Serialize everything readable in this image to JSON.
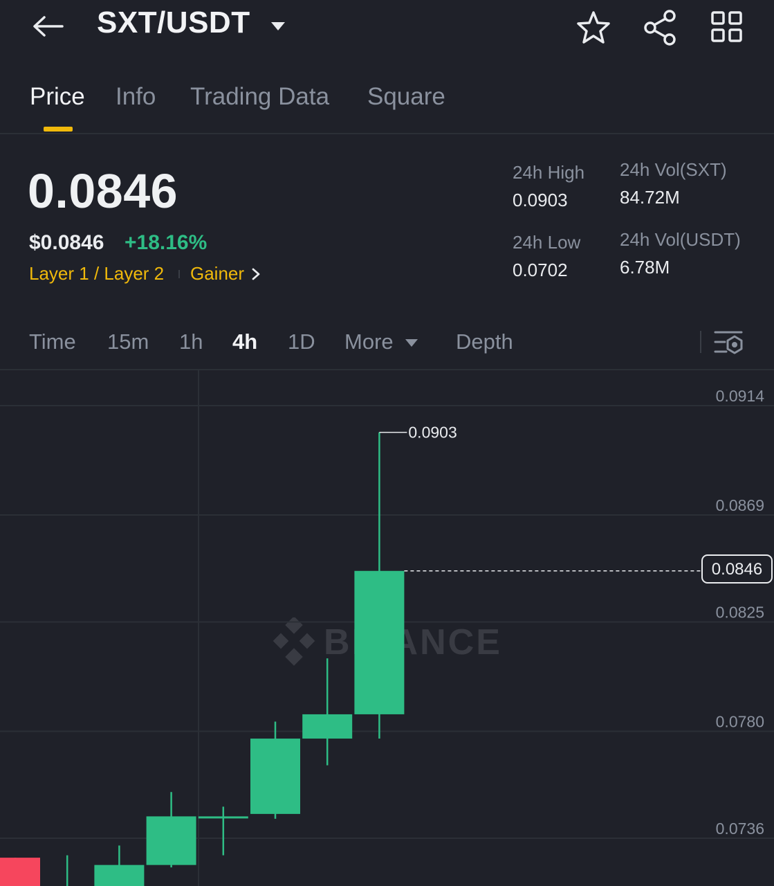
{
  "header": {
    "pair": "SXT/USDT",
    "icons": [
      "back-arrow-icon",
      "caret-down-icon",
      "star-icon",
      "share-icon",
      "grid-icon"
    ]
  },
  "tabs": [
    {
      "label": "Price",
      "active": true
    },
    {
      "label": "Info",
      "active": false
    },
    {
      "label": "Trading Data",
      "active": false
    },
    {
      "label": "Square",
      "active": false
    }
  ],
  "price": {
    "last": "0.0846",
    "usd": "$0.0846",
    "change": "+18.16%",
    "tags": [
      "Layer 1 / Layer 2",
      "Gainer"
    ]
  },
  "stats": {
    "high_label": "24h High",
    "high_value": "0.0903",
    "low_label": "24h Low",
    "low_value": "0.0702",
    "vol_sxt_label": "24h Vol(SXT)",
    "vol_sxt_value": "84.72M",
    "vol_usdt_label": "24h Vol(USDT)",
    "vol_usdt_value": "6.78M"
  },
  "intervals": [
    {
      "label": "Time",
      "active": false
    },
    {
      "label": "15m",
      "active": false
    },
    {
      "label": "1h",
      "active": false
    },
    {
      "label": "4h",
      "active": true
    },
    {
      "label": "1D",
      "active": false
    },
    {
      "label": "More",
      "active": false
    },
    {
      "label": "Depth",
      "active": false
    }
  ],
  "colors": {
    "background": "#1f2129",
    "up": "#2ebd85",
    "down": "#f6465d",
    "accent": "#f0b90b",
    "muted": "#8a919e"
  },
  "chart": {
    "y_axis_labels": [
      "0.0914",
      "0.0869",
      "0.0825",
      "0.0780",
      "0.0736"
    ],
    "high_marker": "0.0903",
    "current_price": "0.0846",
    "watermark": "BINANCE"
  },
  "chart_data": {
    "type": "candlestick",
    "interval": "4h",
    "y_ticks": [
      0.0914,
      0.0869,
      0.0825,
      0.078,
      0.0736
    ],
    "candles": [
      {
        "open": 0.0728,
        "high": 0.0728,
        "low": 0.0712,
        "close": 0.0712,
        "dir": "down"
      },
      {
        "open": 0.071,
        "high": 0.0729,
        "low": 0.0709,
        "close": 0.0711,
        "dir": "up"
      },
      {
        "open": 0.0711,
        "high": 0.0733,
        "low": 0.071,
        "close": 0.0725,
        "dir": "up"
      },
      {
        "open": 0.0725,
        "high": 0.0755,
        "low": 0.0724,
        "close": 0.0745,
        "dir": "up"
      },
      {
        "open": 0.0745,
        "high": 0.0749,
        "low": 0.0729,
        "close": 0.0745,
        "dir": "up"
      },
      {
        "open": 0.0746,
        "high": 0.0784,
        "low": 0.0744,
        "close": 0.0777,
        "dir": "up"
      },
      {
        "open": 0.0777,
        "high": 0.081,
        "low": 0.0766,
        "close": 0.0787,
        "dir": "up"
      },
      {
        "open": 0.0787,
        "high": 0.0903,
        "low": 0.0777,
        "close": 0.0846,
        "dir": "up"
      }
    ]
  }
}
